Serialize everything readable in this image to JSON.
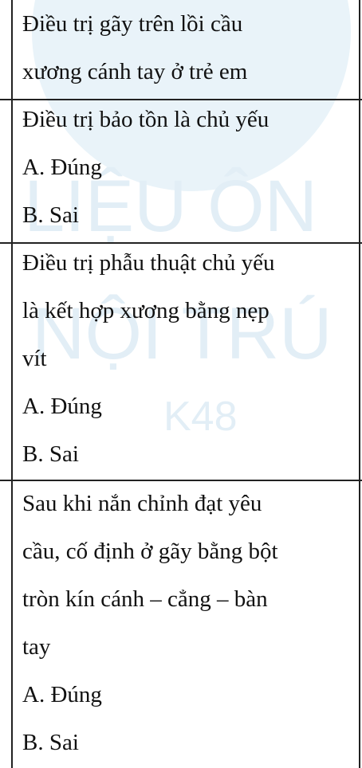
{
  "watermark": {
    "line1": "LIỆU ÔN",
    "line2": "NỘI TRÚ",
    "line3": "K48"
  },
  "cells": [
    {
      "lines": [
        "Điều trị gãy trên lồi cầu",
        "xương cánh tay ở trẻ em"
      ]
    },
    {
      "lines": [
        "Điều trị bảo tồn là chủ yếu",
        "A. Đúng",
        "B. Sai"
      ]
    },
    {
      "lines": [
        "Điều trị  phẫu thuật chủ yếu",
        "là kết hợp xương bằng nẹp",
        "vít",
        "A. Đúng",
        "B.  Sai"
      ]
    },
    {
      "lines": [
        "Sau khi nắn chỉnh đạt yêu",
        "cầu, cố định ở gãy bằng bột",
        "tròn kín cánh – cẳng – bàn",
        "tay",
        "A. Đúng",
        "B. Sai"
      ]
    }
  ]
}
